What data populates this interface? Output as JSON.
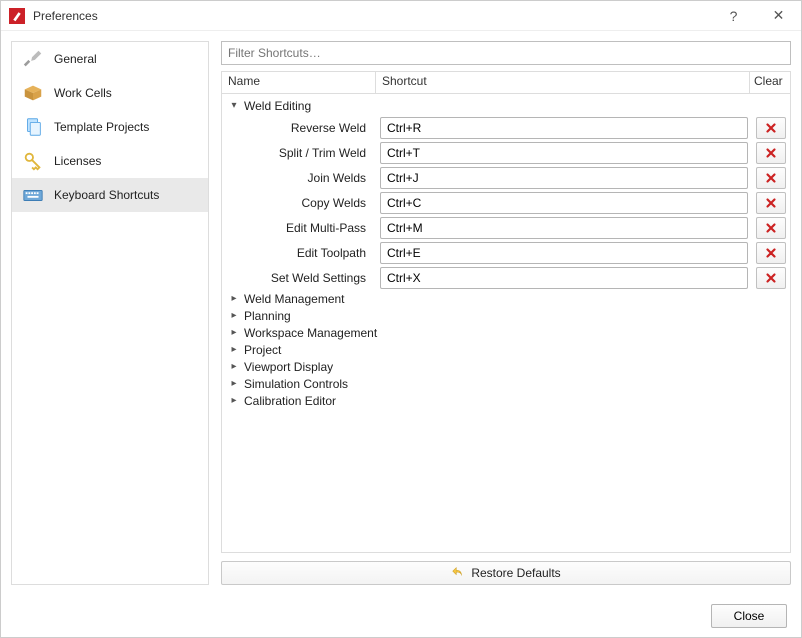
{
  "window": {
    "title": "Preferences",
    "help": "?",
    "close_glyph": "✕"
  },
  "sidebar": {
    "items": [
      {
        "id": "general",
        "label": "General"
      },
      {
        "id": "workcells",
        "label": "Work Cells"
      },
      {
        "id": "templates",
        "label": "Template Projects"
      },
      {
        "id": "licenses",
        "label": "Licenses"
      },
      {
        "id": "shortcuts",
        "label": "Keyboard Shortcuts"
      }
    ],
    "selected": "shortcuts"
  },
  "filter": {
    "placeholder": "Filter Shortcuts…",
    "value": ""
  },
  "columns": {
    "name": "Name",
    "shortcut": "Shortcut",
    "clear": "Clear"
  },
  "expanded_category": {
    "label": "Weld Editing",
    "actions": [
      {
        "name": "Reverse Weld",
        "shortcut": "Ctrl+R"
      },
      {
        "name": "Split / Trim Weld",
        "shortcut": "Ctrl+T"
      },
      {
        "name": "Join Welds",
        "shortcut": "Ctrl+J"
      },
      {
        "name": "Copy Welds",
        "shortcut": "Ctrl+C"
      },
      {
        "name": "Edit Multi-Pass",
        "shortcut": "Ctrl+M"
      },
      {
        "name": "Edit Toolpath",
        "shortcut": "Ctrl+E"
      },
      {
        "name": "Set Weld Settings",
        "shortcut": "Ctrl+X"
      }
    ]
  },
  "collapsed_categories": [
    "Weld Management",
    "Planning",
    "Workspace Management",
    "Project",
    "Viewport Display",
    "Simulation Controls",
    "Calibration Editor"
  ],
  "buttons": {
    "restore": "Restore Defaults",
    "close": "Close"
  }
}
